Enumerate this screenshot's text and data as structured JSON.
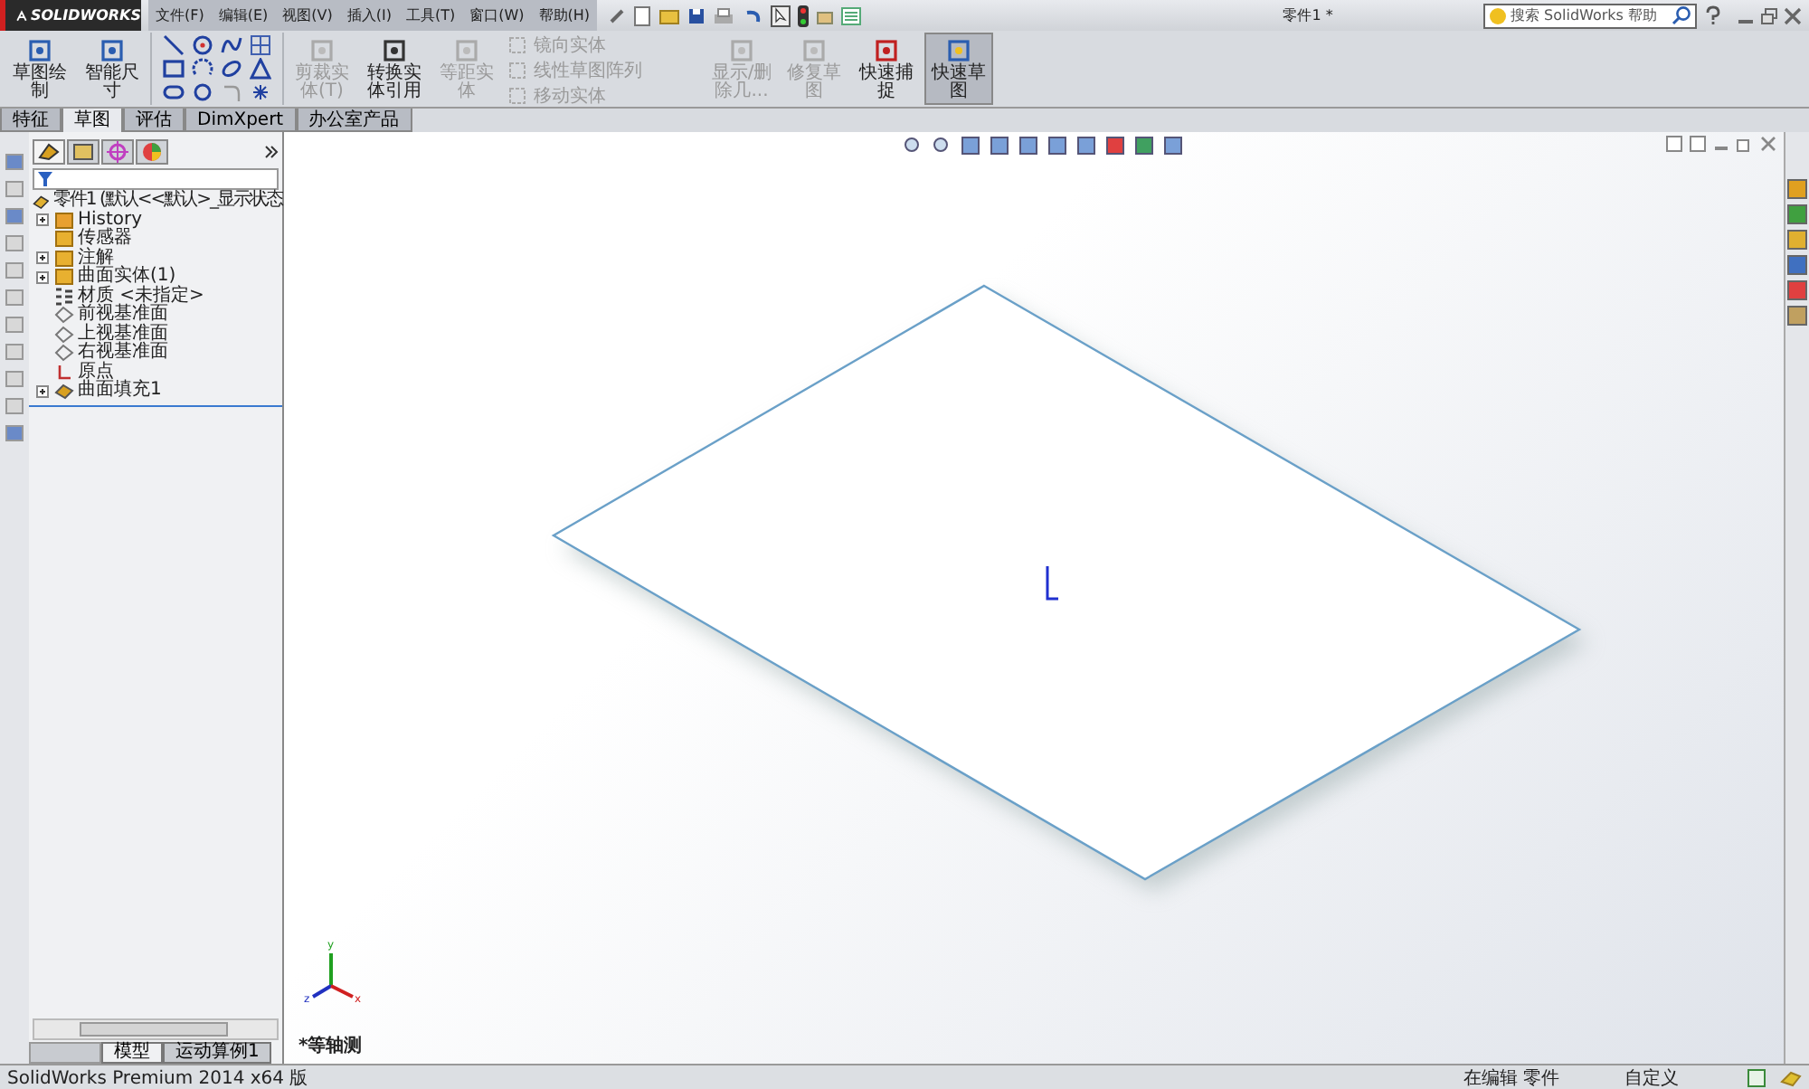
{
  "title_bar": {
    "logo": "SOLIDWORKS",
    "menus": [
      "文件(F)",
      "编辑(E)",
      "视图(V)",
      "插入(I)",
      "工具(T)",
      "窗口(W)",
      "帮助(H)"
    ],
    "title": "零件1 *",
    "search": {
      "placeholder": "搜索 SolidWorks 帮助"
    }
  },
  "ribbon": [
    {
      "kind": "large",
      "label": "草图绘制",
      "disabled": false,
      "on": false
    },
    {
      "kind": "large",
      "label": "智能尺寸",
      "disabled": false,
      "on": false
    },
    {
      "kind": "tools"
    },
    {
      "kind": "large",
      "label": "剪裁实体(T)",
      "disabled": true,
      "on": false
    },
    {
      "kind": "large",
      "label": "转换实体引用",
      "disabled": false,
      "on": false
    },
    {
      "kind": "large",
      "label": "等距实体",
      "disabled": true,
      "on": false
    },
    {
      "kind": "stack",
      "items": [
        {
          "label": "镜向实体",
          "disabled": true
        },
        {
          "label": "线性草图阵列",
          "disabled": true
        },
        {
          "label": "移动实体",
          "disabled": true
        }
      ]
    },
    {
      "kind": "large",
      "label": "显示/删除几...",
      "disabled": true,
      "on": false
    },
    {
      "kind": "large",
      "label": "修复草图",
      "disabled": true,
      "on": false
    },
    {
      "kind": "large",
      "label": "快速捕捉",
      "disabled": false,
      "on": false
    },
    {
      "kind": "large",
      "label": "快速草图",
      "disabled": false,
      "on": true
    }
  ],
  "command_tabs": [
    {
      "label": "特征",
      "selected": false
    },
    {
      "label": "草图",
      "selected": true
    },
    {
      "label": "评估",
      "selected": false
    },
    {
      "label": "DimXpert",
      "selected": false
    },
    {
      "label": "办公室产品",
      "selected": false
    }
  ],
  "feature_tree": {
    "root": "零件1 (默认<<默认>_显示状态",
    "items": [
      {
        "label": "History",
        "kind": "history",
        "collapsed": true
      },
      {
        "label": "传感器",
        "kind": "sensor",
        "collapsed": false
      },
      {
        "label": "注解",
        "kind": "annotation",
        "collapsed": true
      },
      {
        "label": "曲面实体(1)",
        "kind": "body",
        "collapsed": true
      },
      {
        "label": "材质 <未指定>",
        "kind": "material",
        "collapsed": false
      },
      {
        "label": "前视基准面",
        "kind": "plane",
        "collapsed": false
      },
      {
        "label": "上视基准面",
        "kind": "plane",
        "collapsed": false
      },
      {
        "label": "右视基准面",
        "kind": "plane",
        "collapsed": false
      },
      {
        "label": "原点",
        "kind": "origin",
        "collapsed": false
      },
      {
        "label": "曲面填充1",
        "kind": "feature",
        "collapsed": true
      }
    ]
  },
  "bottom_tabs": [
    {
      "label": "模型",
      "selected": true
    },
    {
      "label": "运动算例1",
      "selected": false
    }
  ],
  "viewport": {
    "view_name": "*等轴测",
    "triad": [
      "y",
      "z",
      "x"
    ]
  },
  "status_bar": {
    "product": "SolidWorks Premium 2014 x64 版",
    "mode": "在编辑 零件",
    "units": "自定义"
  }
}
